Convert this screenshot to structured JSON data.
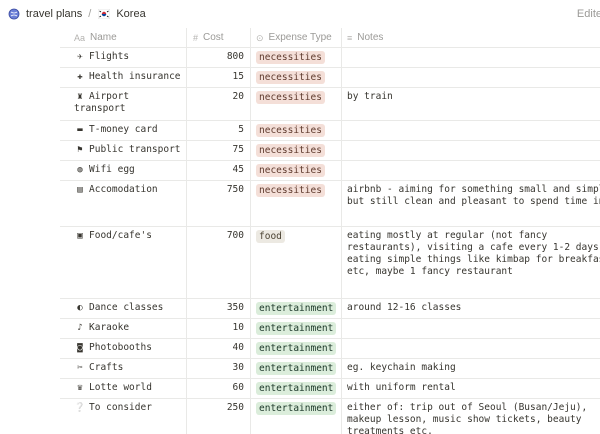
{
  "breadcrumb": {
    "parent": "travel plans",
    "separator": "/",
    "current": "Korea",
    "edit": "Edite"
  },
  "table": {
    "headers": {
      "name": "Name",
      "name_icon": "Aa",
      "cost": "Cost",
      "cost_icon": "#",
      "type": "Expense Type",
      "type_icon": "⊙",
      "notes": "Notes",
      "notes_icon": "≡"
    },
    "rows": [
      {
        "icon": "✈",
        "icon_name": "airplane-icon",
        "name": "Flights",
        "cost": "800",
        "type": "necessities",
        "notes": ""
      },
      {
        "icon": "✚",
        "icon_name": "hospital-icon",
        "name": "Health insurance",
        "cost": "15",
        "type": "necessities",
        "notes": ""
      },
      {
        "icon": "♜",
        "icon_name": "luggage-icon",
        "name": "Airport transport",
        "cost": "20",
        "type": "necessities",
        "notes": "by train"
      },
      {
        "icon": "▬",
        "icon_name": "credit-card-icon",
        "name": "T-money card",
        "cost": "5",
        "type": "necessities",
        "notes": ""
      },
      {
        "icon": "⚑",
        "icon_name": "bus-icon",
        "name": "Public transport",
        "cost": "75",
        "type": "necessities",
        "notes": ""
      },
      {
        "icon": "◍",
        "icon_name": "globe-icon",
        "name": "Wifi egg",
        "cost": "45",
        "type": "necessities",
        "notes": ""
      },
      {
        "icon": "▤",
        "icon_name": "hotel-icon",
        "name": "Accomodation",
        "cost": "750",
        "type": "necessities",
        "notes": "airbnb - aiming for something small and simple, but still clean and pleasant to spend time in"
      },
      {
        "icon": "▣",
        "icon_name": "bento-icon",
        "name": "Food/cafe's",
        "cost": "700",
        "type": "food",
        "notes": "eating mostly at regular (not fancy restaurants), visiting a cafe every 1-2 days, eating simple things like kimbap for breakfast etc, maybe 1 fancy restaurant"
      },
      {
        "icon": "◐",
        "icon_name": "ballet-shoes-icon",
        "name": "Dance classes",
        "cost": "350",
        "type": "entertainment",
        "notes": "around 12-16 classes"
      },
      {
        "icon": "♪",
        "icon_name": "microphone-icon",
        "name": "Karaoke",
        "cost": "10",
        "type": "entertainment",
        "notes": ""
      },
      {
        "icon": "◙",
        "icon_name": "camera-icon",
        "name": "Photobooths",
        "cost": "40",
        "type": "entertainment",
        "notes": ""
      },
      {
        "icon": "✂",
        "icon_name": "craft-icon",
        "name": "Crafts",
        "cost": "30",
        "type": "entertainment",
        "notes": "eg. keychain making"
      },
      {
        "icon": "♛",
        "icon_name": "ferris-wheel-icon",
        "name": "Lotte world",
        "cost": "60",
        "type": "entertainment",
        "notes": "with uniform rental"
      },
      {
        "icon": "❔",
        "icon_name": "question-icon",
        "name": "To consider",
        "cost": "250",
        "type": "entertainment",
        "notes": "either of: trip out of Seoul (Busan/Jeju), makeup lesson, music show tickets, beauty treatments etc."
      }
    ]
  },
  "colors": {
    "necessities_bg": "#f4dfd8",
    "food_bg": "#ece9e2",
    "entertainment_bg": "#dbeddb",
    "border": "#e9e9e7",
    "muted_text": "#9b9a97"
  }
}
